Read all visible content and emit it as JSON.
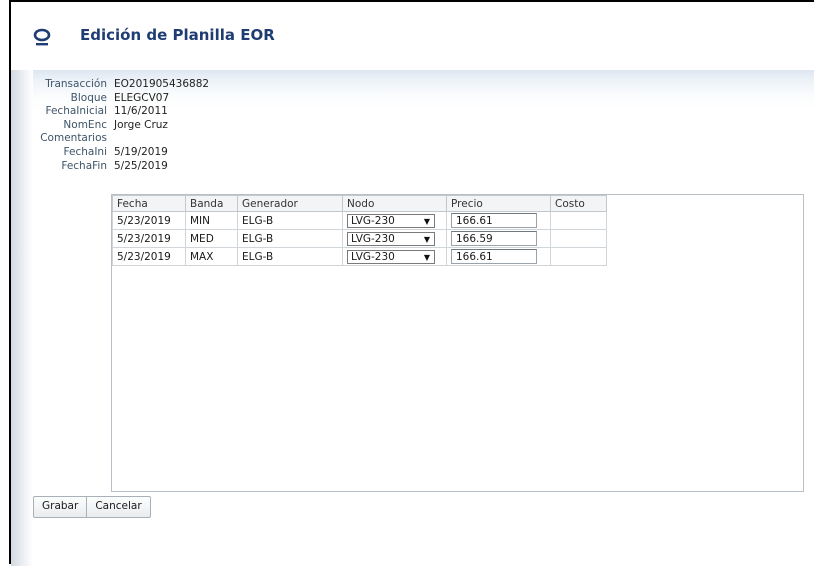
{
  "header": {
    "title": "Edición de Planilla EOR",
    "logo_icon": "oracle-ring-icon"
  },
  "form": {
    "fields": [
      {
        "label": "Transacción",
        "value": "EO201905436882"
      },
      {
        "label": "Bloque",
        "value": "ELEGCV07"
      },
      {
        "label": "FechaInicial",
        "value": "11/6/2011"
      },
      {
        "label": "NomEnc",
        "value": "Jorge Cruz"
      },
      {
        "label": "Comentarios",
        "value": ""
      },
      {
        "label": "FechaIni",
        "value": "5/19/2019"
      },
      {
        "label": "FechaFin",
        "value": "5/25/2019"
      }
    ]
  },
  "table": {
    "columns": [
      "Fecha",
      "Banda",
      "Generador",
      "Nodo",
      "Precio",
      "Costo"
    ],
    "rows": [
      {
        "fecha": "5/23/2019",
        "banda": "MIN",
        "generador": "ELG-B",
        "nodo": "LVG-230",
        "precio": "166.61",
        "costo": ""
      },
      {
        "fecha": "5/23/2019",
        "banda": "MED",
        "generador": "ELG-B",
        "nodo": "LVG-230",
        "precio": "166.59",
        "costo": ""
      },
      {
        "fecha": "5/23/2019",
        "banda": "MAX",
        "generador": "ELG-B",
        "nodo": "LVG-230",
        "precio": "166.61",
        "costo": ""
      }
    ]
  },
  "buttons": {
    "save": "Grabar",
    "cancel": "Cancelar"
  },
  "colors": {
    "title": "#1f3c73",
    "logo": "#1f3c73",
    "label": "#3e5468"
  }
}
